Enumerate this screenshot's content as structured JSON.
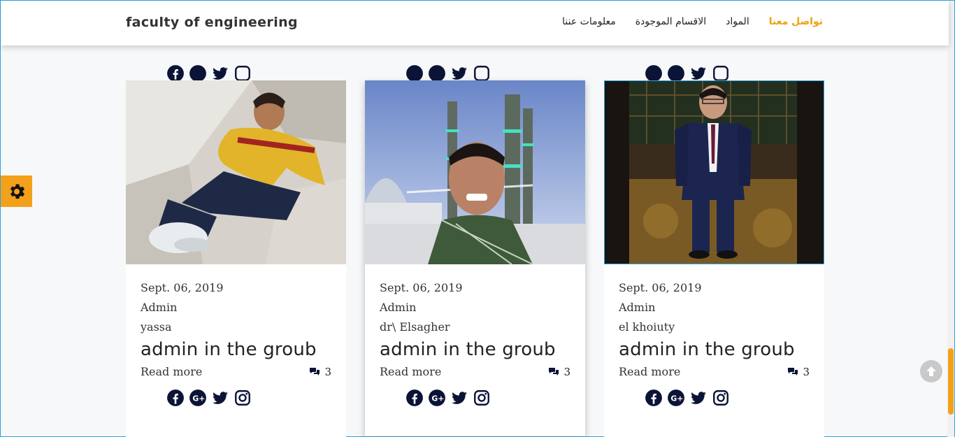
{
  "navbar": {
    "brand": "faculty of engineering",
    "links": [
      {
        "label": "تواصل معنا",
        "active": true
      },
      {
        "label": "المواد",
        "active": false
      },
      {
        "label": "الاقسام الموجودة",
        "active": false
      },
      {
        "label": "معلومات عننا",
        "active": false
      }
    ]
  },
  "cards": [
    {
      "date": "Sept. 06, 2019",
      "author": "Admin",
      "name": "yassa",
      "title": "admin in the groub",
      "read_more": "Read more",
      "comments": "3"
    },
    {
      "date": "Sept. 06, 2019",
      "author": "Admin",
      "name": "dr\\ Elsagher",
      "title": "admin in the groub",
      "read_more": "Read more",
      "comments": "3"
    },
    {
      "date": "Sept. 06, 2019",
      "author": "Admin",
      "name": "el khoiuty",
      "title": "admin in the groub",
      "read_more": "Read more",
      "comments": "3"
    }
  ],
  "icons": {
    "settings": "gear-icon",
    "scroll_top": "arrow-up-circle-icon",
    "comments": "comments-icon",
    "social": [
      "facebook-icon",
      "google-plus-icon",
      "twitter-icon",
      "instagram-icon"
    ]
  },
  "colors": {
    "accent": "#f3a01a",
    "active_link": "#f0a012",
    "social_icons": "#0b1436"
  }
}
